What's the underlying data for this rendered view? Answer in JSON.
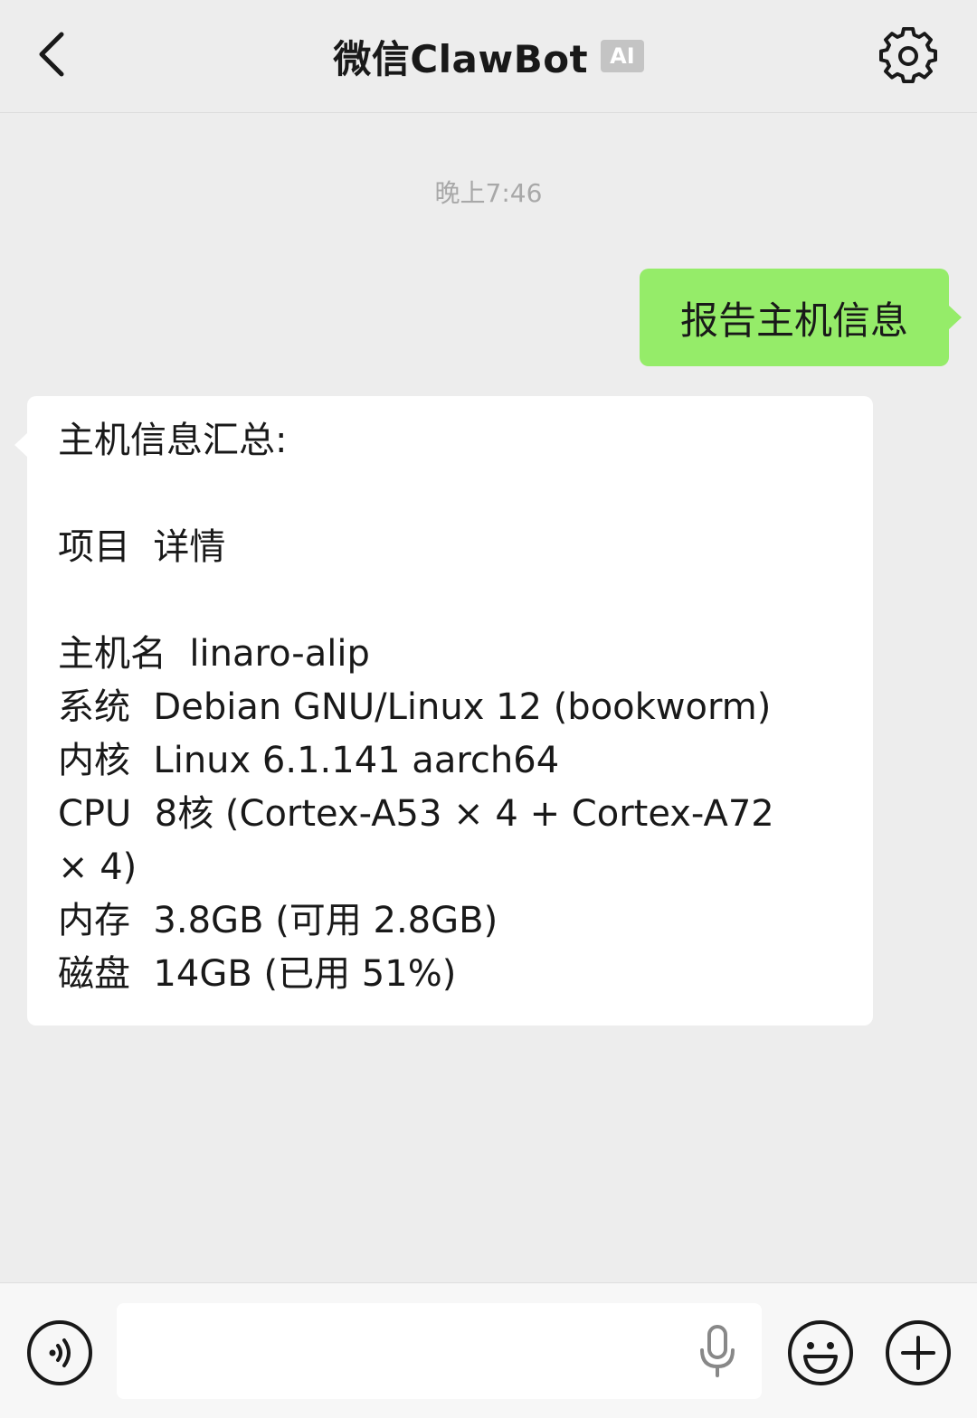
{
  "header": {
    "title": "微信ClawBot",
    "badge": "AI",
    "back_icon": "chevron-left-icon",
    "settings_icon": "gear-icon"
  },
  "chat": {
    "timestamp": "晚上7:46",
    "outgoing_message": "报告主机信息",
    "reply_lines": [
      "主机信息汇总:",
      "",
      "项目  详情",
      "",
      "主机名  linaro-alip",
      "系统  Debian GNU/Linux 12 (bookworm)",
      "内核  Linux 6.1.141 aarch64",
      "CPU  8核 (Cortex-A53 × 4 + Cortex-A72",
      "× 4)",
      "内存  3.8GB (可用 2.8GB)",
      "磁盘  14GB (已用 51%)"
    ]
  },
  "input_bar": {
    "text_value": "",
    "voice_icon": "voice-toggle-icon",
    "mic_icon": "microphone-icon",
    "emoji_icon": "emoji-icon",
    "plus_icon": "plus-icon"
  },
  "colors": {
    "background": "#ededed",
    "outgoing_bubble": "#95ec69",
    "incoming_bubble": "#ffffff",
    "badge": "#c4c4c4"
  }
}
